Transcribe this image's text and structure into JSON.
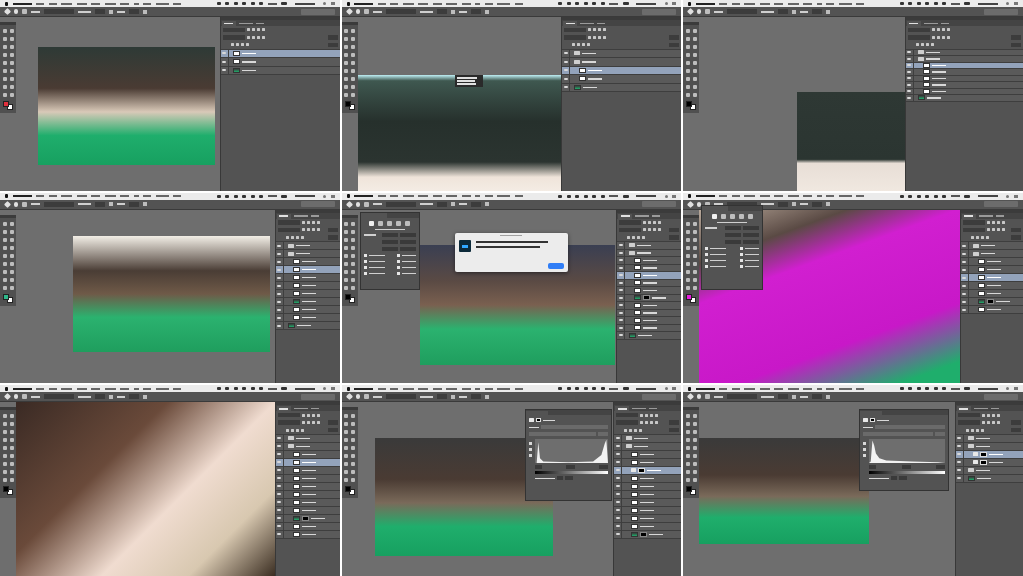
{
  "frames": [
    {
      "kind": "canvas"
    },
    {
      "kind": "brush_tip"
    },
    {
      "kind": "canvas"
    },
    {
      "kind": "canvas"
    },
    {
      "kind": "liquify_error"
    },
    {
      "kind": "clone_overlay"
    },
    {
      "kind": "canvas"
    },
    {
      "kind": "levels"
    },
    {
      "kind": "levels"
    }
  ]
}
